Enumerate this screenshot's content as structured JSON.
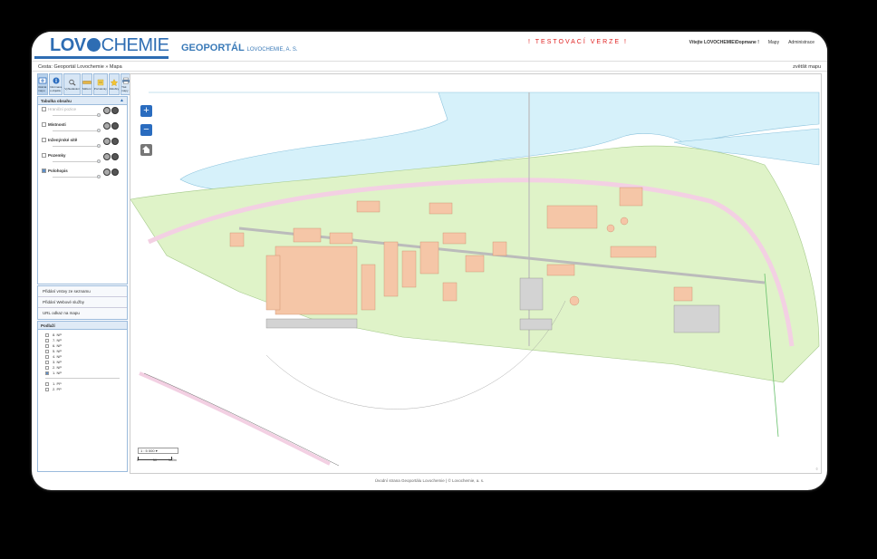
{
  "header": {
    "logo_part1": "LOV",
    "logo_part2": "CHEMIE",
    "geoportal_title": "GEOPORTÁL",
    "geoportal_sub": "LOVOCHEMIE, A. S.",
    "test_banner": "! TESTOVACÍ VERZE !",
    "nav": {
      "greeting": "Vítejte LOVOCHEMIE\\Dopmane !",
      "maps": "Mapy",
      "admin": "Administrace"
    }
  },
  "breadcrumb": {
    "prefix": "Cesta:",
    "items": [
      "Geoportál Lovochemie",
      "Mapa"
    ],
    "separator": "»",
    "enlarge": "zvětšit mapu"
  },
  "toolbar": {
    "tools": [
      {
        "label": "Ukázat mapu",
        "icon": "pan-icon"
      },
      {
        "label": "Informace o objektu",
        "icon": "info-icon"
      },
      {
        "label": "Vyhledávání",
        "icon": "search-icon"
      },
      {
        "label": "Měření",
        "icon": "measure-icon"
      },
      {
        "label": "Poznámky",
        "icon": "note-icon"
      },
      {
        "label": "Záložky",
        "icon": "bookmark-icon"
      },
      {
        "label": "Tisk mapy",
        "icon": "print-icon"
      }
    ]
  },
  "layers_panel": {
    "title": "Tabulka obsahu",
    "layers": [
      {
        "label": "Hraniční pozice",
        "checked": false,
        "dim": true
      },
      {
        "label": "Místnosti",
        "checked": false,
        "dim": false
      },
      {
        "label": "Inženýrské sítě",
        "checked": false,
        "dim": false
      },
      {
        "label": "Pozemky",
        "checked": false,
        "dim": false
      },
      {
        "label": "Polohopis",
        "checked": true,
        "dim": false
      }
    ]
  },
  "side_links": [
    "Přidání vrstvy ze seznamu",
    "Přidání Webové služby",
    "URL odkaz na mapu"
  ],
  "floors_panel": {
    "title": "Podlaží",
    "floors": [
      {
        "label": "8. NP",
        "checked": false
      },
      {
        "label": "7. NP",
        "checked": false
      },
      {
        "label": "6. NP",
        "checked": false
      },
      {
        "label": "5. NP",
        "checked": false
      },
      {
        "label": "4. NP",
        "checked": false
      },
      {
        "label": "3. NP",
        "checked": false
      },
      {
        "label": "2. NP",
        "checked": false
      },
      {
        "label": "1. NP",
        "checked": true
      }
    ],
    "basement": [
      {
        "label": "1. PP",
        "checked": false
      },
      {
        "label": "2. PP",
        "checked": false
      }
    ]
  },
  "map": {
    "zoom_in": "+",
    "zoom_out": "−",
    "scale_value": "1 : 5 000",
    "scale_ticks": [
      "0",
      "50",
      "100m"
    ],
    "corner": "©"
  },
  "footer": {
    "home": "Úvodní strana Geoportálu Lovochemie",
    "copyright": "© Lovochemie, a. s."
  },
  "colors": {
    "brand_blue": "#2e6db3",
    "test_red": "#e02020",
    "water": "#d6f1fa",
    "ground": "#dff3c8",
    "building": "#f5c6a7",
    "rail": "#f3d0e3"
  }
}
